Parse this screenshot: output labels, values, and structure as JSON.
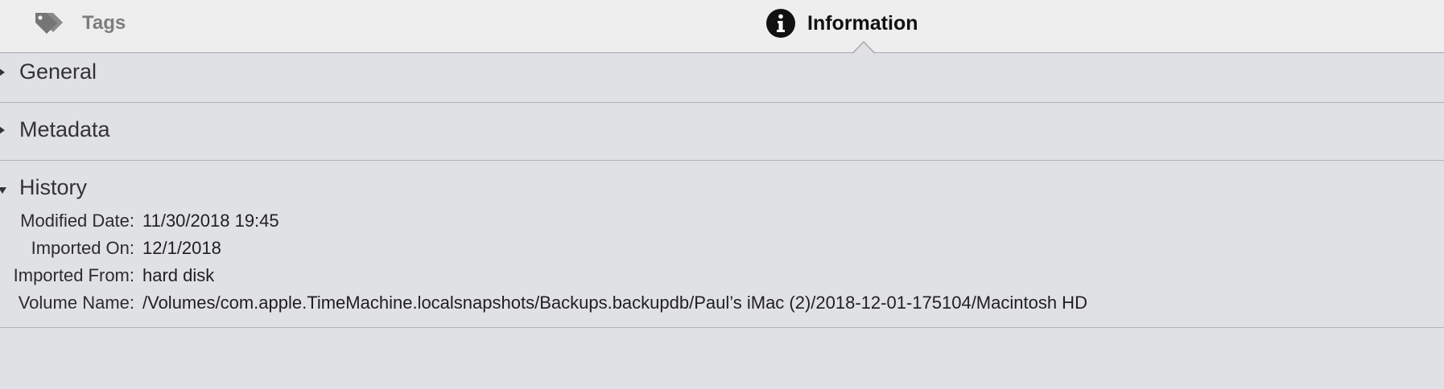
{
  "tabs": {
    "tags": {
      "label": "Tags",
      "icon": "tag-icon"
    },
    "information": {
      "label": "Information",
      "icon": "info-icon",
      "selected": true
    }
  },
  "sections": {
    "general": {
      "title": "General",
      "expanded": false
    },
    "metadata": {
      "title": "Metadata",
      "expanded": false
    },
    "history": {
      "title": "History",
      "expanded": true,
      "rows": [
        {
          "label": "Modified Date:",
          "value": "11/30/2018 19:45"
        },
        {
          "label": "Imported On:",
          "value": "12/1/2018"
        },
        {
          "label": "Imported From:",
          "value": "hard disk"
        },
        {
          "label": "Volume Name:",
          "value": "/Volumes/com.apple.TimeMachine.localsnapshots/Backups.backupdb/Paul’s iMac (2)/2018-12-01-175104/Macintosh HD"
        }
      ]
    }
  },
  "colors": {
    "background": "#e0e1e5",
    "tabbar": "#eeeeee",
    "divider": "#b2b3b8"
  }
}
